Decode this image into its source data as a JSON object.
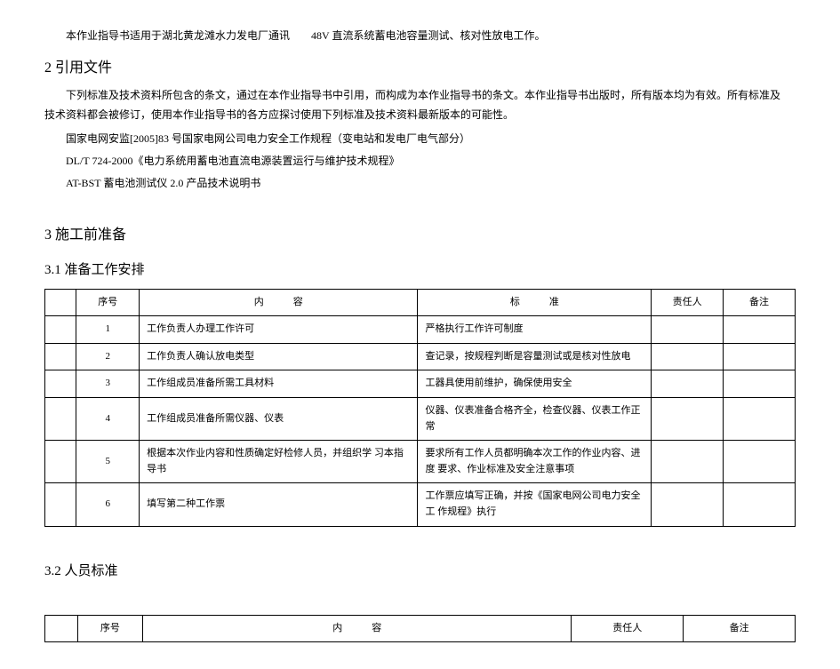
{
  "intro": "本作业指导书适用于湖北黄龙滩水力发电厂通讯　　48V 直流系统蓄电池容量测试、核对性放电工作。",
  "section2": {
    "title": "2 引用文件",
    "para": "下列标准及技术资料所包含的条文，通过在本作业指导书中引用，而构成为本作业指导书的条文。本作业指导书出版时，所有版本均为有效。所有标准及　技术资料都会被修订，使用本作业指导书的各方应探讨使用下列标准及技术资料最新版本的可能性。",
    "refs": [
      "国家电网安监[2005]83 号国家电网公司电力安全工作规程（变电站和发电厂电气部分）",
      "DL/T 724-2000《电力系统用蓄电池直流电源装置运行与维护技术规程》",
      "AT-BST 蓄电池测试仪 2.0 产品技术说明书"
    ]
  },
  "section3": {
    "title": "3 施工前准备"
  },
  "section31": {
    "title": "3.1 准备工作安排",
    "headers": {
      "seq": "序号",
      "content": "内　　　容",
      "standard": "标　　　准",
      "person": "责任人",
      "remark": "备注"
    },
    "rows": [
      {
        "seq": "1",
        "content": "工作负责人办理工作许可",
        "standard": "严格执行工作许可制度"
      },
      {
        "seq": "2",
        "content": "工作负责人确认放电类型",
        "standard": "查记录，按规程判断是容量测试或是核对性放电"
      },
      {
        "seq": "3",
        "content": "工作组成员准备所需工具材料",
        "standard": "工器具使用前维护，确保使用安全"
      },
      {
        "seq": "4",
        "content": "工作组成员准备所需仪器、仪表",
        "standard": "仪器、仪表准备合格齐全，检查仪器、仪表工作正常"
      },
      {
        "seq": "5",
        "content": "根据本次作业内容和性质确定好检修人员，并组织学  习本指导书",
        "standard": "要求所有工作人员都明确本次工作的作业内容、进度  要求、作业标准及安全注意事项"
      },
      {
        "seq": "6",
        "content": "填写第二种工作票",
        "standard": "工作票应填写正确，并按《国家电网公司电力安全工  作规程》执行"
      }
    ]
  },
  "section32": {
    "title": "3.2 人员标准",
    "headers": {
      "seq": "序号",
      "content": "内　　　容",
      "person": "责任人",
      "remark": "备注"
    }
  }
}
